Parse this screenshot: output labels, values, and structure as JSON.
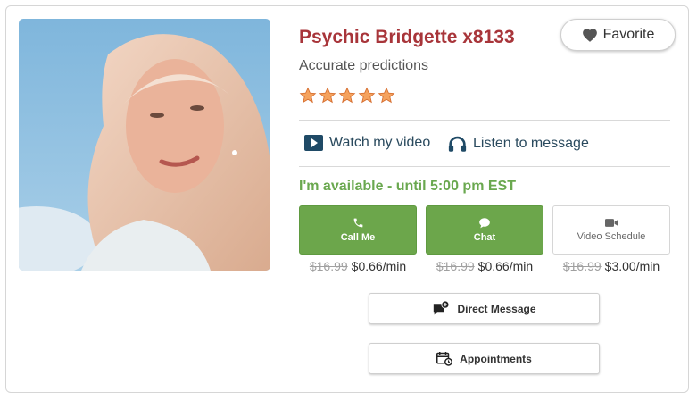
{
  "psychic": {
    "name": "Psychic Bridgette x8133",
    "tagline": "Accurate predictions",
    "rating": 5
  },
  "favorite": {
    "label": "Favorite",
    "icon": "heart-icon"
  },
  "media": {
    "video_label": "Watch my video",
    "video_icon": "play-icon",
    "message_label": "Listen to message",
    "message_icon": "headphones-icon"
  },
  "availability": "I'm available - until 5:00 pm EST",
  "contact_buttons": [
    {
      "label": "Call Me",
      "icon": "phone-icon",
      "old_price": "$16.99",
      "price": "$0.66/min"
    },
    {
      "label": "Chat",
      "icon": "chat-bubble-icon",
      "old_price": "$16.99",
      "price": "$0.66/min"
    },
    {
      "label": "Video Schedule",
      "icon": "video-camera-icon",
      "old_price": "$16.99",
      "price": "$3.00/min"
    }
  ],
  "actions": {
    "direct_message": "Direct Message",
    "appointments": "Appointments"
  },
  "colors": {
    "name": "#a8353a",
    "available": "#6aa84f",
    "button_green": "#6ca64b",
    "star": "#f08a3c"
  }
}
